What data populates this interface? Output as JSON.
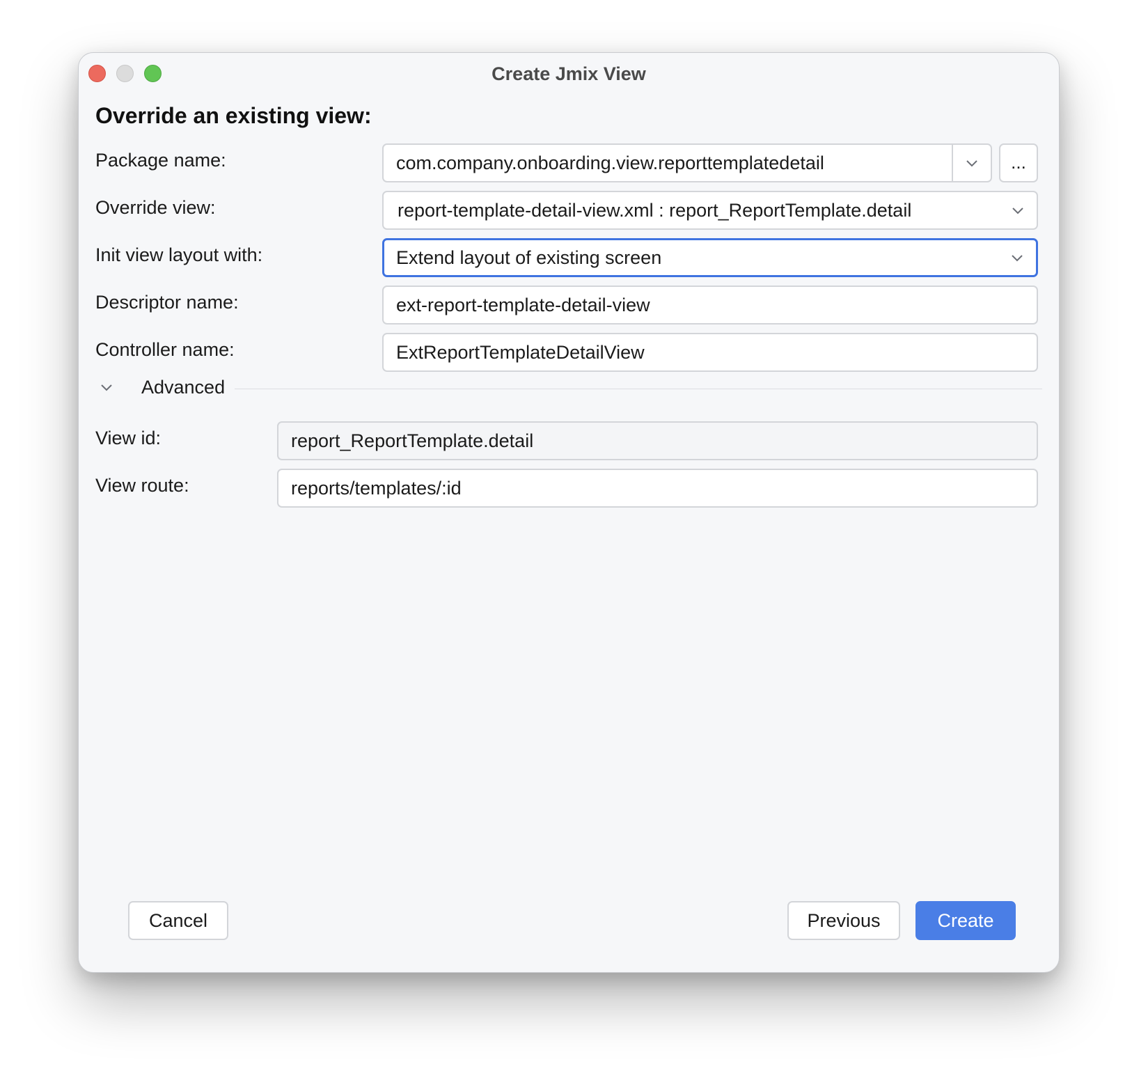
{
  "window": {
    "title": "Create Jmix View"
  },
  "form": {
    "heading": "Override an existing view:",
    "package_name": {
      "label": "Package name:",
      "value": "com.company.onboarding.view.reporttemplatedetail",
      "browse_label": "..."
    },
    "override_view": {
      "label": "Override view:",
      "value": "report-template-detail-view.xml : report_ReportTemplate.detail"
    },
    "init_layout": {
      "label": "Init view layout with:",
      "value": "Extend layout of existing screen"
    },
    "descriptor_name": {
      "label": "Descriptor name:",
      "value": "ext-report-template-detail-view"
    },
    "controller_name": {
      "label": "Controller name:",
      "value": "ExtReportTemplateDetailView"
    }
  },
  "advanced": {
    "label": "Advanced",
    "expanded": true,
    "view_id": {
      "label": "View id:",
      "value": "report_ReportTemplate.detail"
    },
    "view_route": {
      "label": "View route:",
      "value": "reports/templates/:id"
    }
  },
  "buttons": {
    "cancel": "Cancel",
    "previous": "Previous",
    "create": "Create"
  },
  "colors": {
    "accent": "#4a7ee6",
    "focus_border": "#3f73e0",
    "window_bg": "#f6f7f9",
    "close": "#ec6a5e",
    "minimize": "#dcdcdc",
    "maximize": "#61c554"
  }
}
